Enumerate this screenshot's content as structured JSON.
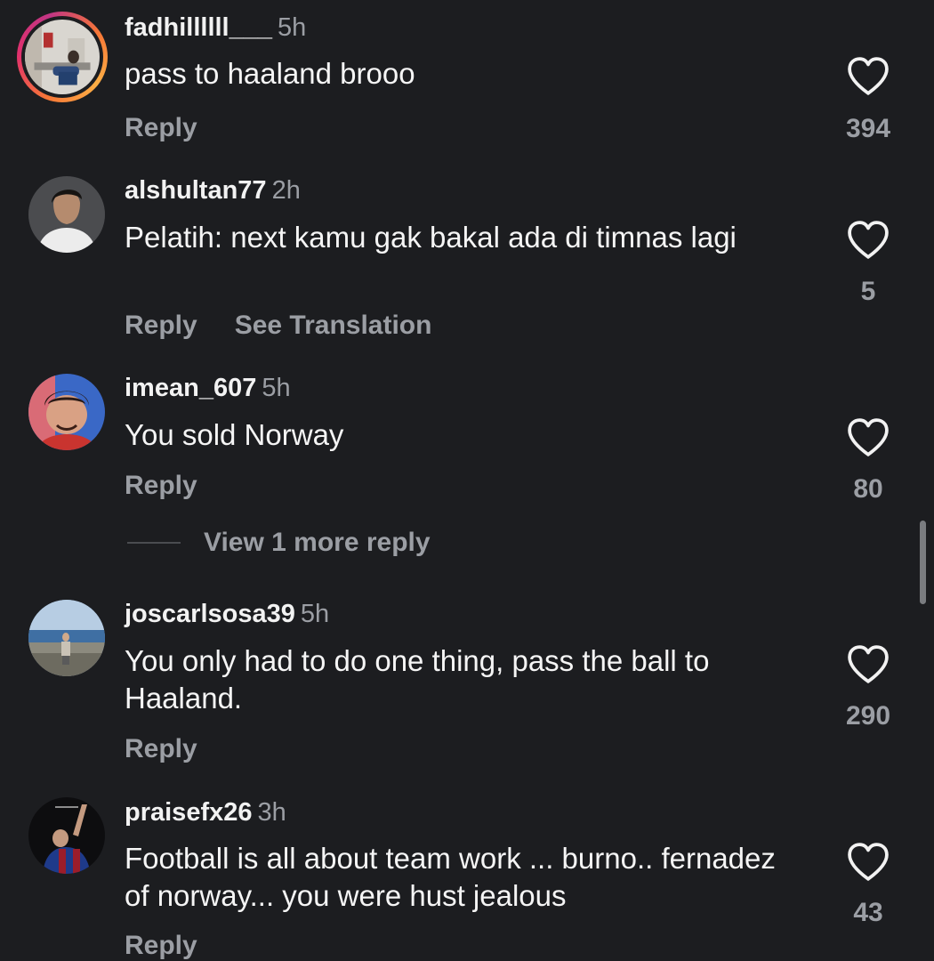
{
  "comments": [
    {
      "username": "fadhillllll___",
      "time": "5h",
      "text": "pass to haaland brooo",
      "reply_label": "Reply",
      "likes": "394"
    },
    {
      "username": "alshultan77",
      "time": "2h",
      "text": "Pelatih: next kamu gak bakal ada di timnas lagi",
      "reply_label": "Reply",
      "translate_label": "See Translation",
      "likes": "5"
    },
    {
      "username": "imean_607",
      "time": "5h",
      "text": "You sold Norway",
      "reply_label": "Reply",
      "likes": "80",
      "view_more_label": "View 1 more reply"
    },
    {
      "username": "joscarlsosa39",
      "time": "5h",
      "text": "You only had to do one thing, pass the ball to Haaland.",
      "reply_label": "Reply",
      "likes": "290"
    },
    {
      "username": "praisefx26",
      "time": "3h",
      "text": "Football is all about team work ... burno.. fernadez of norway... you were hust jealous",
      "reply_label": "Reply",
      "likes": "43"
    }
  ],
  "icons": {
    "like": "heart-outline-icon"
  },
  "colors": {
    "background": "#1c1d20",
    "primary_text": "#f5f5f5",
    "secondary_text": "#9b9ea4",
    "story_ring_start": "#f77737",
    "story_ring_end": "#c13584"
  }
}
